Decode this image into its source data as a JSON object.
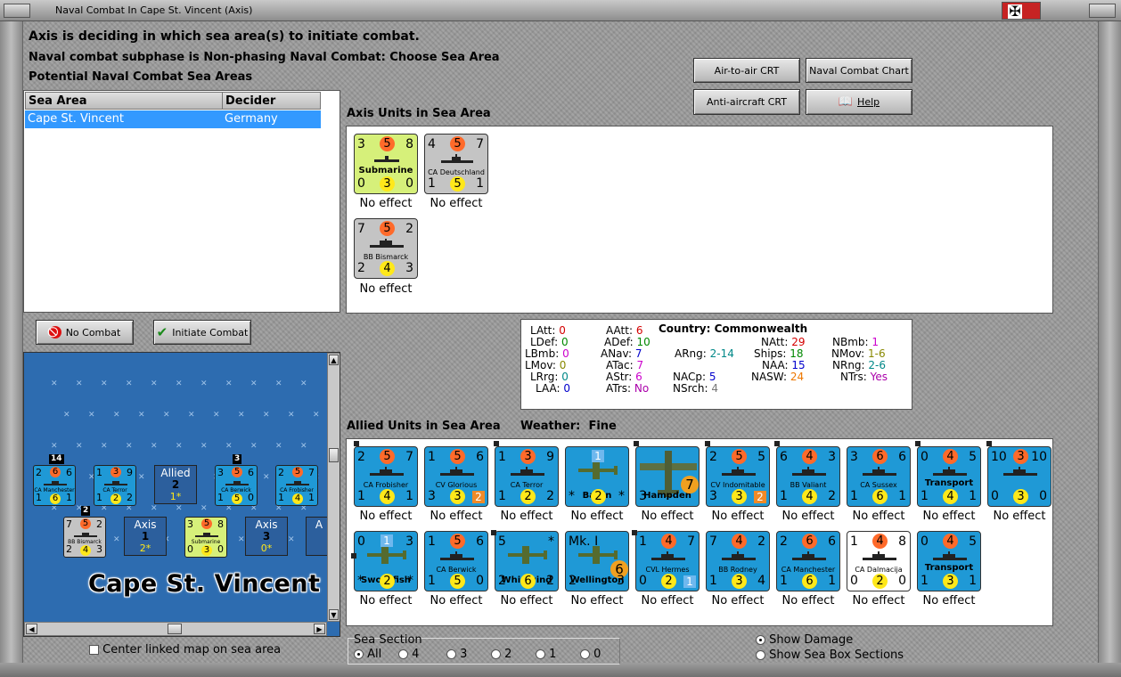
{
  "window": {
    "title": "Naval Combat In Cape St. Vincent (Axis)"
  },
  "header": {
    "line1": "Axis is deciding in which sea area(s) to initiate combat.",
    "line2": "Naval combat subphase is Non-phasing Naval Combat: Choose Sea Area",
    "line3": "Potential Naval Combat Sea Areas"
  },
  "buttons": {
    "air_to_air": "Air-to-air CRT",
    "naval_chart": "Naval Combat Chart",
    "anti_aircraft": "Anti-aircraft CRT",
    "help": "Help",
    "no_combat": "No Combat",
    "initiate_combat": "Initiate Combat"
  },
  "sea_table": {
    "headers": [
      "Sea Area",
      "Decider"
    ],
    "rows": [
      {
        "area": "Cape St. Vincent",
        "decider": "Germany"
      }
    ]
  },
  "axis_units": {
    "label": "Axis Units in Sea Area",
    "units": [
      {
        "tl": "3",
        "top": "5",
        "tr": "8",
        "bl": "0",
        "bot": "3",
        "br": "0",
        "name": "Submarine",
        "status": "No effect"
      },
      {
        "tl": "4",
        "top": "5",
        "tr": "7",
        "bl": "1",
        "bot": "5",
        "br": "1",
        "name": "CA Deutschland",
        "status": "No effect"
      },
      {
        "tl": "7",
        "top": "5",
        "tr": "2",
        "bl": "2",
        "bot": "4",
        "br": "3",
        "name": "BB Bismarck",
        "status": "No effect"
      }
    ]
  },
  "stats": {
    "country_label": "Country:",
    "country": "Commonwealth",
    "items": [
      {
        "k": "LAtt:",
        "v": "0",
        "color": "#d40000"
      },
      {
        "k": "LDef:",
        "v": "0",
        "color": "#008800"
      },
      {
        "k": "LBmb:",
        "v": "0",
        "color": "#cc00cc"
      },
      {
        "k": "LMov:",
        "v": "0",
        "color": "#888800"
      },
      {
        "k": "LRrg:",
        "v": "0",
        "color": "#008888"
      },
      {
        "k": "LAA:",
        "v": "0",
        "color": "#0000cc"
      },
      {
        "k": "AAtt:",
        "v": "6",
        "color": "#d40000"
      },
      {
        "k": "ADef:",
        "v": "10",
        "color": "#008800"
      },
      {
        "k": "ANav:",
        "v": "7",
        "color": "#0000cc"
      },
      {
        "k": "ATac:",
        "v": "7",
        "color": "#cc00cc"
      },
      {
        "k": "AStr:",
        "v": "6",
        "color": "#cc00cc"
      },
      {
        "k": "ATrs:",
        "v": "No",
        "color": "#aa00aa"
      },
      {
        "k": "ARng:",
        "v": "2-14",
        "color": "#008888"
      },
      {
        "k": "NACp:",
        "v": "5",
        "color": "#0000cc"
      },
      {
        "k": "NSrch:",
        "v": "4",
        "color": "#777777"
      },
      {
        "k": "NAtt:",
        "v": "29",
        "color": "#d40000"
      },
      {
        "k": "Ships:",
        "v": "18",
        "color": "#008800"
      },
      {
        "k": "NAA:",
        "v": "15",
        "color": "#0000cc"
      },
      {
        "k": "NASW:",
        "v": "24",
        "color": "#ee7700"
      },
      {
        "k": "NBmb:",
        "v": "1",
        "color": "#cc00cc"
      },
      {
        "k": "NMov:",
        "v": "1-6",
        "color": "#888800"
      },
      {
        "k": "NRng:",
        "v": "2-6",
        "color": "#008888"
      },
      {
        "k": "NTrs:",
        "v": "Yes",
        "color": "#aa00aa"
      }
    ]
  },
  "allied": {
    "label": "Allied Units in Sea Area",
    "weather_label": "Weather:",
    "weather": "Fine",
    "units": [
      {
        "tl": "2",
        "top": "5",
        "tr": "7",
        "bl": "1",
        "bot": "4",
        "br": "1",
        "name": "CA Frobisher",
        "status": "No effect"
      },
      {
        "tl": "1",
        "top": "5",
        "tr": "6",
        "bl": "3",
        "bot": "3",
        "br": "2",
        "name": "CV Glorious",
        "status": "No effect"
      },
      {
        "tl": "1",
        "top": "3",
        "tr": "9",
        "bl": "1",
        "bot": "2",
        "br": "2",
        "name": "CA Terror",
        "status": "No effect"
      },
      {
        "tl": "",
        "top": "1",
        "tr": "",
        "bl": "*",
        "bot": "2",
        "br": "*",
        "name": "Baffin",
        "status": "No effect"
      },
      {
        "tl": "",
        "top": "",
        "tr": "",
        "bl": "3",
        "bot": "7",
        "br": "",
        "name": "Hampden",
        "status": "No effect"
      },
      {
        "tl": "2",
        "top": "5",
        "tr": "5",
        "bl": "3",
        "bot": "3",
        "br": "2",
        "name": "CV Indomitable",
        "status": "No effect"
      },
      {
        "tl": "6",
        "top": "4",
        "tr": "3",
        "bl": "1",
        "bot": "4",
        "br": "2",
        "name": "BB Valiant",
        "status": "No effect"
      },
      {
        "tl": "3",
        "top": "6",
        "tr": "6",
        "bl": "1",
        "bot": "6",
        "br": "1",
        "name": "CA Sussex",
        "status": "No effect"
      },
      {
        "tl": "0",
        "top": "4",
        "tr": "5",
        "bl": "1",
        "bot": "4",
        "br": "1",
        "name": "Transport",
        "status": "No effect"
      },
      {
        "tl": "10",
        "top": "3",
        "tr": "10",
        "bl": "0",
        "bot": "3",
        "br": "0",
        "name": "",
        "status": "No effect"
      },
      {
        "tl": "0",
        "top": "1",
        "tr": "3",
        "bl": "*",
        "bot": "2",
        "br": "*",
        "name": "Swordfish",
        "status": "No effect"
      },
      {
        "tl": "1",
        "top": "5",
        "tr": "6",
        "bl": "1",
        "bot": "5",
        "br": "0",
        "name": "CA Berwick",
        "status": "No effect"
      },
      {
        "tl": "5",
        "top": "",
        "tr": "*",
        "bl": "2",
        "bot": "6",
        "br": "2",
        "name": "Whirlwind",
        "status": "No effect"
      },
      {
        "tl": "Mk. I",
        "top": "",
        "tr": "",
        "bl": "2",
        "bot": "6",
        "br": "3",
        "name": "Wellington",
        "status": "No effect"
      },
      {
        "tl": "1",
        "top": "4",
        "tr": "7",
        "bl": "0",
        "bot": "2",
        "br": "1",
        "name": "CVL Hermes",
        "status": "No effect"
      },
      {
        "tl": "7",
        "top": "4",
        "tr": "2",
        "bl": "1",
        "bot": "3",
        "br": "4",
        "name": "BB Rodney",
        "status": "No effect"
      },
      {
        "tl": "2",
        "top": "6",
        "tr": "6",
        "bl": "1",
        "bot": "6",
        "br": "1",
        "name": "CA Manchester",
        "status": "No effect"
      },
      {
        "tl": "1",
        "top": "4",
        "tr": "8",
        "bl": "0",
        "bot": "2",
        "br": "0",
        "name": "CA Dalmacija",
        "status": "No effect"
      },
      {
        "tl": "0",
        "top": "4",
        "tr": "5",
        "bl": "1",
        "bot": "3",
        "br": "1",
        "name": "Transport",
        "status": "No effect"
      }
    ]
  },
  "map": {
    "name": "Cape St. Vincent",
    "allied_box": {
      "title": "Allied",
      "num": "2",
      "sub": "1*"
    },
    "axis_box1": {
      "title": "Axis",
      "num": "1",
      "sub": "2*"
    },
    "axis_box2": {
      "title": "Axis",
      "num": "3",
      "sub": "0*"
    },
    "axis_box3": {
      "title": "A"
    },
    "stack_labels": [
      "14",
      "3",
      "2"
    ],
    "counters": [
      {
        "tl": "2",
        "top": "6",
        "tr": "6",
        "bl": "1",
        "bot": "6",
        "br": "1",
        "name": "CA Manchester"
      },
      {
        "tl": "1",
        "top": "3",
        "tr": "9",
        "bl": "1",
        "bot": "2",
        "br": "2",
        "name": "CA Terror"
      },
      {
        "tl": "3",
        "top": "5",
        "tr": "6",
        "bl": "1",
        "bot": "5",
        "br": "0",
        "name": "CA Berwick"
      },
      {
        "tl": "2",
        "top": "5",
        "tr": "7",
        "bl": "1",
        "bot": "4",
        "br": "1",
        "name": "CA Frobisher"
      },
      {
        "tl": "7",
        "top": "5",
        "tr": "2",
        "bl": "2",
        "bot": "4",
        "br": "3",
        "name": "BB Bismarck"
      },
      {
        "tl": "3",
        "top": "5",
        "tr": "8",
        "bl": "0",
        "bot": "3",
        "br": "0",
        "name": "Submarine"
      }
    ]
  },
  "options": {
    "center_map": "Center linked map on sea area",
    "sea_section_label": "Sea Section",
    "sea_sections": [
      "All",
      "4",
      "3",
      "2",
      "1",
      "0"
    ],
    "show_damage": "Show Damage",
    "show_boxes": "Show Sea Box Sections"
  },
  "colors": {
    "counter_blue": "#1f99d6",
    "selection": "#3399ff"
  }
}
